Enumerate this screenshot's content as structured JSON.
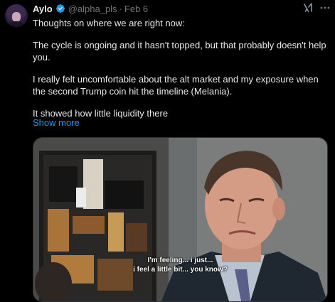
{
  "author": {
    "display_name": "Aylo",
    "handle": "@alpha_pls",
    "separator": "·",
    "date": "Feb 6",
    "verified": true,
    "accent_color": "#1d9bf0"
  },
  "icons": {
    "verified": "verified-badge-icon",
    "grok": "grok-icon",
    "more": "more-options-icon"
  },
  "tweet": {
    "paragraphs": [
      "Thoughts on where we are right now:",
      "The cycle is ongoing and it hasn't topped, but that probably doesn't help you.",
      "I really felt uncomfortable about the alt market and my exposure when the second Trump coin hit the timeline (Melania).",
      "It showed how little liquidity there"
    ],
    "show_more_label": "Show more"
  },
  "media": {
    "subtitle_line_1": "I'm feeling... i just...",
    "subtitle_line_2": "i feel a little bit... you know?"
  }
}
